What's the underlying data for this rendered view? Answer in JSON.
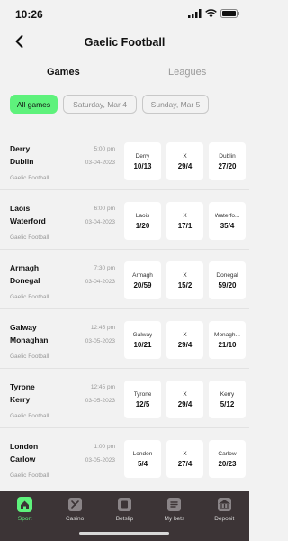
{
  "status_bar": {
    "time": "10:26"
  },
  "header": {
    "title": "Gaelic Football"
  },
  "tabs": [
    {
      "label": "Games",
      "active": true
    },
    {
      "label": "Leagues",
      "active": false
    }
  ],
  "date_filters": [
    {
      "label": "All games",
      "active": true
    },
    {
      "label": "Saturday, Mar 4",
      "active": false
    },
    {
      "label": "Sunday, Mar 5",
      "active": false
    }
  ],
  "matches": [
    {
      "home": "Derry",
      "away": "Dublin",
      "time": "5:00 pm",
      "date": "03-04-2023",
      "league": "Gaelic Football",
      "odds": [
        {
          "label": "Derry",
          "value": "10/13"
        },
        {
          "label": "X",
          "value": "29/4"
        },
        {
          "label": "Dublin",
          "value": "27/20"
        }
      ]
    },
    {
      "home": "Laois",
      "away": "Waterford",
      "time": "6:00 pm",
      "date": "03-04-2023",
      "league": "Gaelic Football",
      "odds": [
        {
          "label": "Laois",
          "value": "1/20"
        },
        {
          "label": "X",
          "value": "17/1"
        },
        {
          "label": "Waterfo...",
          "value": "35/4"
        }
      ]
    },
    {
      "home": "Armagh",
      "away": "Donegal",
      "time": "7:30 pm",
      "date": "03-04-2023",
      "league": "Gaelic Football",
      "odds": [
        {
          "label": "Armagh",
          "value": "20/59"
        },
        {
          "label": "X",
          "value": "15/2"
        },
        {
          "label": "Donegal",
          "value": "59/20"
        }
      ]
    },
    {
      "home": "Galway",
      "away": "Monaghan",
      "time": "12:45 pm",
      "date": "03-05-2023",
      "league": "Gaelic Football",
      "odds": [
        {
          "label": "Galway",
          "value": "10/21"
        },
        {
          "label": "X",
          "value": "29/4"
        },
        {
          "label": "Monagh...",
          "value": "21/10"
        }
      ]
    },
    {
      "home": "Tyrone",
      "away": "Kerry",
      "time": "12:45 pm",
      "date": "03-05-2023",
      "league": "Gaelic Football",
      "odds": [
        {
          "label": "Tyrone",
          "value": "12/5"
        },
        {
          "label": "X",
          "value": "29/4"
        },
        {
          "label": "Kerry",
          "value": "5/12"
        }
      ]
    },
    {
      "home": "London",
      "away": "Carlow",
      "time": "1:00 pm",
      "date": "03-05-2023",
      "league": "Gaelic Football",
      "odds": [
        {
          "label": "London",
          "value": "5/4"
        },
        {
          "label": "X",
          "value": "27/4"
        },
        {
          "label": "Carlow",
          "value": "20/23"
        }
      ]
    }
  ],
  "bottom_nav": [
    {
      "label": "Sport",
      "icon": "home-icon",
      "active": true
    },
    {
      "label": "Casino",
      "icon": "casino-icon",
      "active": false
    },
    {
      "label": "Betslip",
      "icon": "betslip-icon",
      "active": false
    },
    {
      "label": "My bets",
      "icon": "my-bets-icon",
      "active": false
    },
    {
      "label": "Deposit",
      "icon": "deposit-icon",
      "active": false
    }
  ],
  "colors": {
    "accent": "#5ef27c",
    "nav_bg": "#3c3436",
    "page_bg": "#f2f2f2"
  }
}
